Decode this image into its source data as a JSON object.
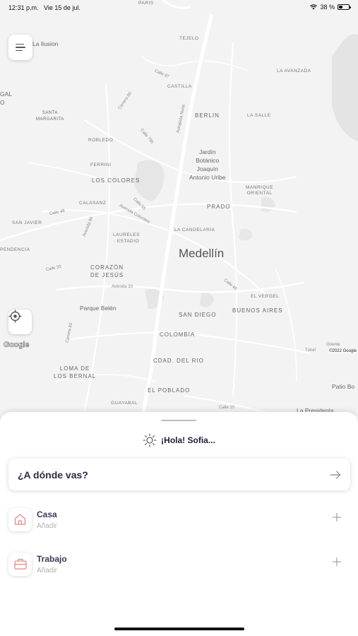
{
  "status_bar": {
    "time": "12:31 p.m.",
    "date": "Vie 15 de jul.",
    "battery": "38 %",
    "battery_level": 0.38
  },
  "map": {
    "labels": {
      "paris": "PARIS",
      "la_ilusion": "La Ilusion",
      "tejelo": "TEJELO",
      "la_avanzada": "LA AVANZADA",
      "gal": "GAL",
      "o": "O",
      "calle97": "Calle 97",
      "castilla": "CASTILLA",
      "carrera80": "Carrera 80",
      "berlin": "BERLIN",
      "la_salle": "LA SALLE",
      "autopista_norte": "Autopista Norte",
      "santa_margarita": "SANTA\nMARGARITA",
      "robledo": "ROBLEDO",
      "calle78b": "Calle 78b",
      "jardin": "Jardín\nBotánico\nJoaquín\nAntonio Uribe",
      "ferrini": "FERRINI",
      "los_colores": "LOS COLORES",
      "manrique": "MANRIQUE\nORIENTAL",
      "calasanz": "CALASANZ",
      "calle55": "Calle 55",
      "prado": "PRADO",
      "calle48": "Calle 48",
      "avenida_colombia": "Avenida Colombia",
      "san_javier": "SAN JAVIER",
      "avenida80": "Avenida 80",
      "laureles": "LAURELES\n- ESTADIO",
      "la_candelaria": "LA CANDELARIA",
      "pendencia": "PENDENCIA",
      "medellin": "Medellín",
      "calle33": "Calle 33",
      "corazon": "CORAZÓN\nDE JESÚS",
      "avenida33": "Avenida 33",
      "calle45": "Calle 45",
      "el_vergel": "EL VERGEL",
      "parque_belen": "Parque Belén",
      "san_diego": "SAN DIEGO",
      "buenos_aires": "BUENOS AIRES",
      "carrera83": "Carrera 83",
      "colombia": "COLOMBIA",
      "tunel": "Túnel",
      "oriente": "Oriente",
      "loma_bernal": "LOMA DE\nLOS BERNAL",
      "cdad_del_rio": "CDAD. DEL RIO",
      "patio_bo": "Patio Bo",
      "el_poblado": "EL POBLADO",
      "guayabal": "GUAYABAL",
      "calle10": "Calle 10",
      "la_presidenta": "La Presidenta"
    },
    "google_logo": "Google",
    "copyright": "©2022 Google"
  },
  "sheet": {
    "greeting": "¡Hola! Sofia...",
    "search_label": "¿A dónde vas?",
    "places": [
      {
        "title": "Casa",
        "subtitle": "Añadir",
        "icon": "home-icon"
      },
      {
        "title": "Trabajo",
        "subtitle": "Añadir",
        "icon": "briefcase-icon"
      }
    ]
  },
  "colors": {
    "accent_icon": "#e28a8a",
    "map_bg": "#f3f3f3",
    "text_dark": "#1d1d3b"
  }
}
